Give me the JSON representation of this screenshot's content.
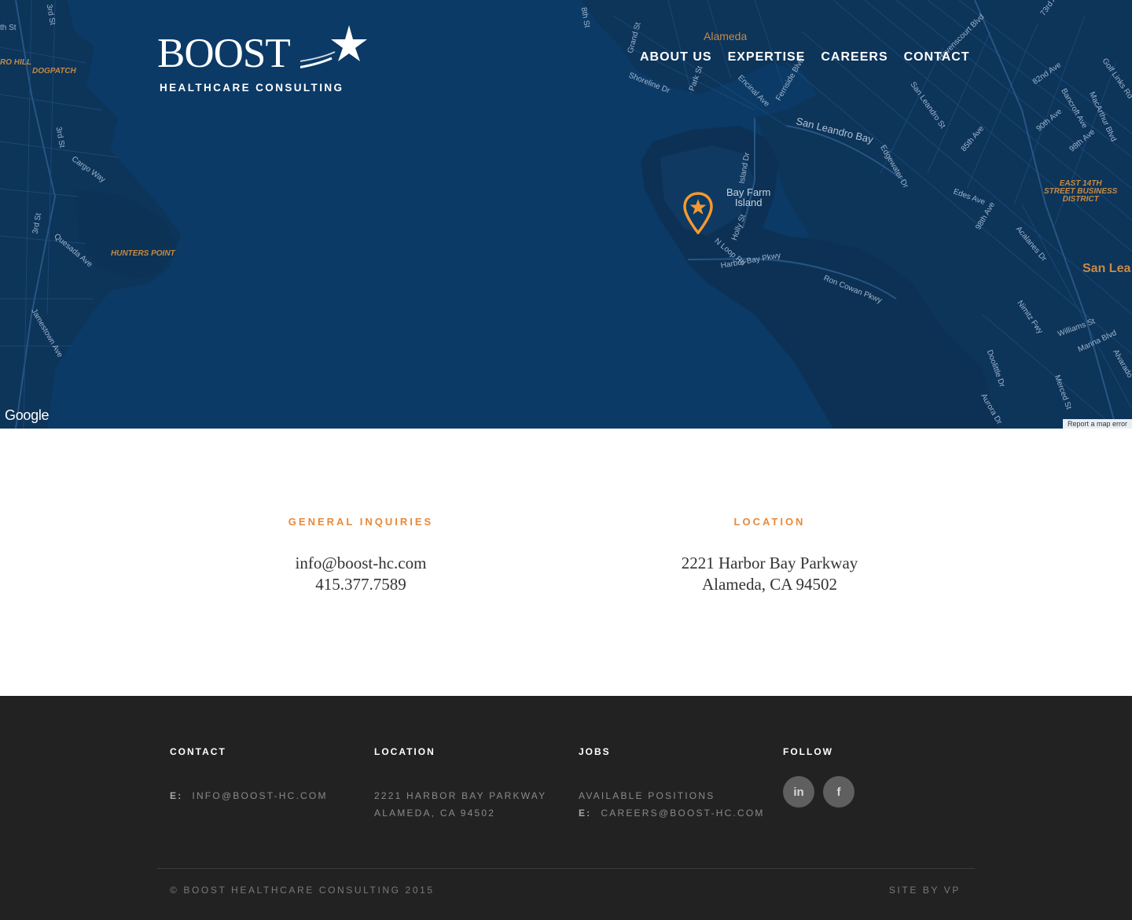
{
  "brand": {
    "name": "BOOST",
    "tagline": "HEALTHCARE CONSULTING"
  },
  "nav": {
    "items": [
      {
        "label": "ABOUT US"
      },
      {
        "label": "EXPERTISE"
      },
      {
        "label": "CAREERS"
      },
      {
        "label": "CONTACT"
      }
    ]
  },
  "map": {
    "attribution": "Google",
    "report_error": "Report a map error",
    "pin_icon": "star-map-pin-icon",
    "labels": {
      "alameda": "Alameda",
      "bay_farm_island_1": "Bay Farm",
      "bay_farm_island_2": "Island",
      "san_leandro_bay": "San Leandro Bay",
      "hunters_point": "HUNTERS POINT",
      "dogpatch": "DOGPATCH",
      "ro_hill": "RO HILL",
      "east_14th_1": "EAST 14TH",
      "east_14th_2": "STREET BUSINESS",
      "east_14th_3": "DISTRICT",
      "san_lea": "San Lea",
      "island_dr": "Island Dr",
      "holly_st": "Holly St",
      "n_loop_rd": "N Loop Rd",
      "harbor_bay_pkwy": "Harbor Bay Pkwy",
      "ron_cowan_pkwy": "Ron Cowan Pkwy",
      "shoreline_dr": "Shoreline Dr",
      "park_st": "Park St",
      "encinal_ave": "Encinal Ave",
      "fernside_blvd": "Fernside Blvd",
      "san_leandro_st": "San Leandro St",
      "edgewater_dr": "Edgewater Dr",
      "edes_ave": "Edes Ave",
      "98th_ave": "98th Ave",
      "85th_ave": "85th Ave",
      "82nd_ave": "82nd Ave",
      "90th_ave": "90th Ave",
      "98th_ave_2": "98th Ave",
      "bancroft_ave": "Bancroft Ave",
      "macarthur_blvd": "MacArthur Blvd",
      "havenscourt_blvd": "Havenscourt Blvd",
      "acalanes_dr": "Acalanes Dr",
      "nimitz_fwy": "Nimitz Fwy",
      "williams_st": "Williams St",
      "marina_blvd": "Marina Blvd",
      "doolittle_dr": "Doolittle Dr",
      "mercedes_st": "Merced St",
      "aurora_dr": "Aurora Dr",
      "alvarado": "Alvarado",
      "cargo_way": "Cargo Way",
      "3rd_st": "3rd St",
      "3rd_st_2": "3rd St",
      "quesada_ave": "Quesada Ave",
      "jamestown_ave": "Jamestown Ave",
      "8th_st": "8th St",
      "grand_st": "Grand St",
      "golf_links": "Golf Links Rd",
      "73rd_av": "73rd Av",
      "3rd_st_top": "3rd St",
      "th_st": "th St"
    }
  },
  "contact_info": {
    "general": {
      "heading": "GENERAL INQUIRIES",
      "email": "info@boost-hc.com",
      "phone": "415.377.7589"
    },
    "location": {
      "heading": "LOCATION",
      "street": "2221 Harbor Bay Parkway",
      "city": "Alameda, CA 94502"
    }
  },
  "footer": {
    "contact": {
      "heading": "CONTACT",
      "email_prefix": "E:",
      "email": "INFO@BOOST-HC.COM"
    },
    "location": {
      "heading": "LOCATION",
      "line1": "2221 HARBOR BAY PARKWAY",
      "line2": "ALAMEDA, CA 94502"
    },
    "jobs": {
      "heading": "JOBS",
      "positions": "AVAILABLE POSITIONS",
      "email_prefix": "E:",
      "email": "CAREERS@BOOST-HC.COM"
    },
    "follow": {
      "heading": "FOLLOW",
      "linkedin": "in",
      "facebook": "f"
    },
    "copyright": "© BOOST HEALTHCARE CONSULTING 2015",
    "site_by": "SITE BY VP"
  },
  "colors": {
    "map_water": "#0b3a66",
    "accent_orange": "#e8893a",
    "footer_bg": "#222222"
  }
}
